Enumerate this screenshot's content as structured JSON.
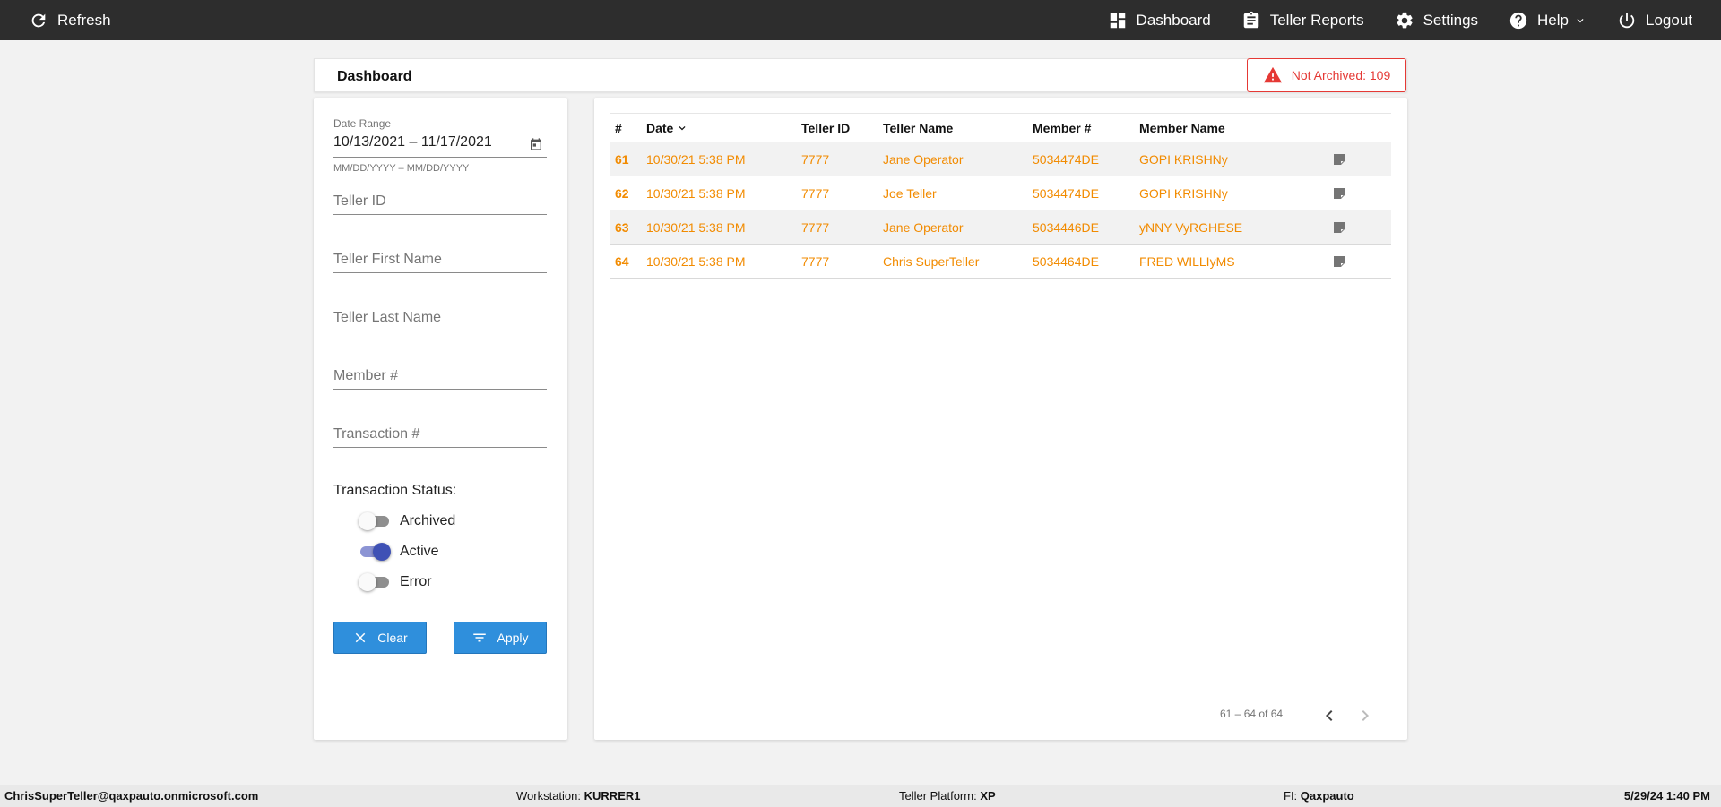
{
  "nav": {
    "refresh": "Refresh",
    "dashboard": "Dashboard",
    "teller_reports": "Teller Reports",
    "settings": "Settings",
    "help": "Help",
    "logout": "Logout"
  },
  "header": {
    "title": "Dashboard",
    "not_archived": "Not Archived: 109"
  },
  "filters": {
    "date_range_label": "Date Range",
    "date_range_value": "10/13/2021 – 11/17/2021",
    "date_hint": "MM/DD/YYYY – MM/DD/YYYY",
    "teller_id_placeholder": "Teller ID",
    "teller_first_name_placeholder": "Teller First Name",
    "teller_last_name_placeholder": "Teller Last Name",
    "member_num_placeholder": "Member #",
    "transaction_num_placeholder": "Transaction #",
    "status_title": "Transaction Status:",
    "statuses": [
      {
        "label": "Archived",
        "on": false
      },
      {
        "label": "Active",
        "on": true
      },
      {
        "label": "Error",
        "on": false
      }
    ],
    "clear_label": "Clear",
    "apply_label": "Apply"
  },
  "table": {
    "headers": {
      "num": "#",
      "date": "Date",
      "teller_id": "Teller ID",
      "teller_name": "Teller Name",
      "member_num": "Member #",
      "member_name": "Member Name"
    },
    "rows": [
      {
        "num": "61",
        "date": "10/30/21 5:38 PM",
        "teller_id": "7777",
        "teller_name": "Jane Operator",
        "member_num": "5034474DE",
        "member_name": "GOPI KRISHNy"
      },
      {
        "num": "62",
        "date": "10/30/21 5:38 PM",
        "teller_id": "7777",
        "teller_name": "Joe Teller",
        "member_num": "5034474DE",
        "member_name": "GOPI KRISHNy"
      },
      {
        "num": "63",
        "date": "10/30/21 5:38 PM",
        "teller_id": "7777",
        "teller_name": "Jane Operator",
        "member_num": "5034446DE",
        "member_name": "yNNY VyRGHESE"
      },
      {
        "num": "64",
        "date": "10/30/21 5:38 PM",
        "teller_id": "7777",
        "teller_name": "Chris SuperTeller",
        "member_num": "5034464DE",
        "member_name": "FRED WILLIyMS"
      }
    ],
    "pager": "61 – 64 of 64"
  },
  "footer": {
    "user": "ChrisSuperTeller@qaxpauto.onmicrosoft.com",
    "workstation_label": "Workstation:",
    "workstation": "KURRER1",
    "platform_label": "Teller Platform:",
    "platform": "XP",
    "fi_label": "FI:",
    "fi": "Qaxpauto",
    "datetime": "5/29/24 1:40 PM"
  },
  "colors": {
    "topbar": "#2d2d2d",
    "accent_orange": "#f28b00",
    "alert_red": "#e53935",
    "button_blue": "#2f8fdc",
    "toggle_active": "#3f51b5"
  }
}
